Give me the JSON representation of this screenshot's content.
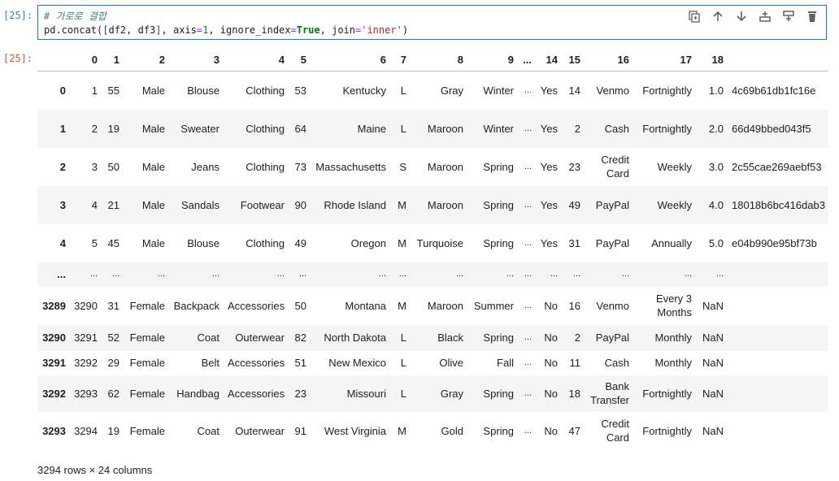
{
  "input_prompt": "[25]:",
  "output_prompt": "[25]:",
  "code": {
    "comment": "# 가로로 결합",
    "line2_parts": [
      "pd.concat(",
      "[",
      "df2, df3",
      "]",
      ", axis",
      "=",
      "1",
      ", ignore_index",
      "=",
      "True",
      ", join",
      "=",
      "'inner'",
      ")"
    ]
  },
  "toolbar": [
    {
      "name": "duplicate-cell-icon",
      "title": "copy"
    },
    {
      "name": "move-up-icon",
      "title": "up"
    },
    {
      "name": "move-down-icon",
      "title": "down"
    },
    {
      "name": "insert-above-icon",
      "title": "insert above"
    },
    {
      "name": "insert-below-icon",
      "title": "insert below"
    },
    {
      "name": "delete-icon",
      "title": "delete"
    }
  ],
  "table": {
    "columns": [
      "",
      "0",
      "1",
      "2",
      "3",
      "4",
      "5",
      "6",
      "7",
      "8",
      "9",
      "...",
      "14",
      "15",
      "16",
      "17",
      "18",
      ""
    ],
    "rows": [
      [
        "0",
        "1",
        "55",
        "Male",
        "Blouse",
        "Clothing",
        "53",
        "Kentucky",
        "L",
        "Gray",
        "Winter",
        "...",
        "Yes",
        "14",
        "Venmo",
        "Fortnightly",
        "1.0",
        "4c69b61db1fc16e"
      ],
      [
        "1",
        "2",
        "19",
        "Male",
        "Sweater",
        "Clothing",
        "64",
        "Maine",
        "L",
        "Maroon",
        "Winter",
        "...",
        "Yes",
        "2",
        "Cash",
        "Fortnightly",
        "2.0",
        "66d49bbed043f5"
      ],
      [
        "2",
        "3",
        "50",
        "Male",
        "Jeans",
        "Clothing",
        "73",
        "Massachusetts",
        "S",
        "Maroon",
        "Spring",
        "...",
        "Yes",
        "23",
        "Credit Card",
        "Weekly",
        "3.0",
        "2c55cae269aebf53"
      ],
      [
        "3",
        "4",
        "21",
        "Male",
        "Sandals",
        "Footwear",
        "90",
        "Rhode Island",
        "M",
        "Maroon",
        "Spring",
        "...",
        "Yes",
        "49",
        "PayPal",
        "Weekly",
        "4.0",
        "18018b6bc416dab3"
      ],
      [
        "4",
        "5",
        "45",
        "Male",
        "Blouse",
        "Clothing",
        "49",
        "Oregon",
        "M",
        "Turquoise",
        "Spring",
        "...",
        "Yes",
        "31",
        "PayPal",
        "Annually",
        "5.0",
        "e04b990e95bf73b"
      ],
      [
        "...",
        "...",
        "...",
        "...",
        "...",
        "...",
        "...",
        "...",
        "...",
        "...",
        "...",
        "...",
        "...",
        "...",
        "...",
        "...",
        "...",
        ""
      ],
      [
        "3289",
        "3290",
        "31",
        "Female",
        "Backpack",
        "Accessories",
        "50",
        "Montana",
        "M",
        "Maroon",
        "Summer",
        "...",
        "No",
        "16",
        "Venmo",
        "Every 3 Months",
        "NaN",
        ""
      ],
      [
        "3290",
        "3291",
        "52",
        "Female",
        "Coat",
        "Outerwear",
        "82",
        "North Dakota",
        "L",
        "Black",
        "Spring",
        "...",
        "No",
        "2",
        "PayPal",
        "Monthly",
        "NaN",
        ""
      ],
      [
        "3291",
        "3292",
        "29",
        "Female",
        "Belt",
        "Accessories",
        "51",
        "New Mexico",
        "L",
        "Olive",
        "Fall",
        "...",
        "No",
        "11",
        "Cash",
        "Monthly",
        "NaN",
        ""
      ],
      [
        "3292",
        "3293",
        "62",
        "Female",
        "Handbag",
        "Accessories",
        "23",
        "Missouri",
        "L",
        "Gray",
        "Spring",
        "...",
        "No",
        "18",
        "Bank Transfer",
        "Fortnightly",
        "NaN",
        ""
      ],
      [
        "3293",
        "3294",
        "19",
        "Female",
        "Coat",
        "Outerwear",
        "91",
        "West Virginia",
        "M",
        "Gold",
        "Spring",
        "...",
        "No",
        "47",
        "Credit Card",
        "Fortnightly",
        "NaN",
        ""
      ]
    ]
  },
  "footer": "3294 rows × 24 columns"
}
